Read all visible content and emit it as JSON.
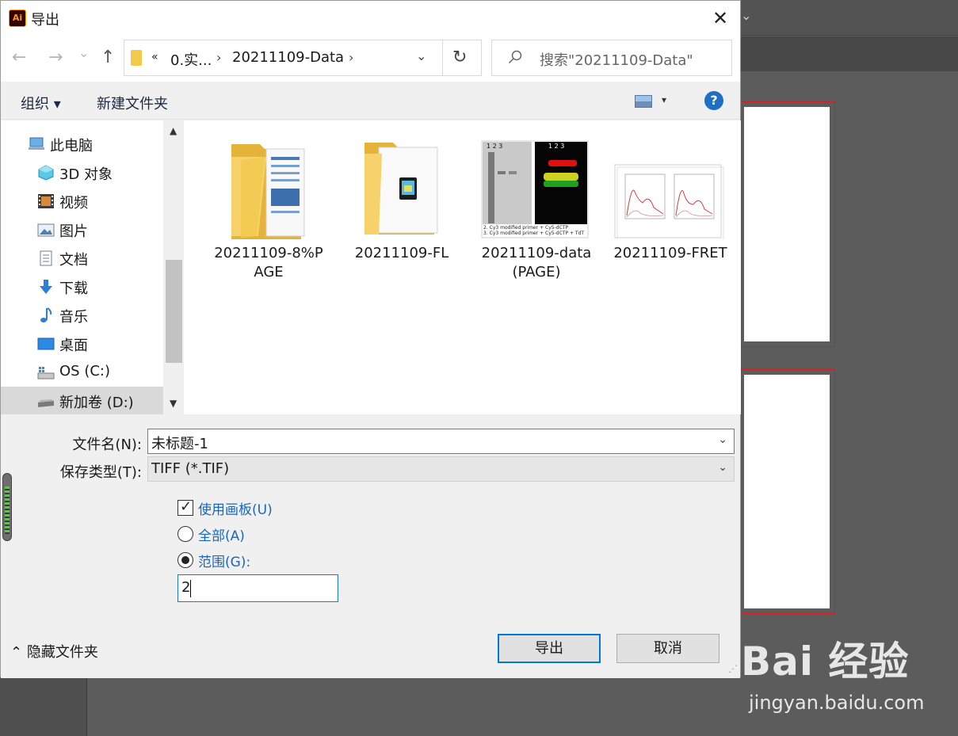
{
  "dialog": {
    "title": "导出",
    "app_icon_text": "Ai",
    "close_glyph": "✕"
  },
  "nav": {
    "back_glyph": "←",
    "forward_glyph": "→",
    "recent_glyph": "⌄",
    "up_glyph": "↑",
    "breadcrumb": [
      "«",
      "0.实...",
      "20211109-Data"
    ],
    "crumb_sep": "›",
    "dropdown_glyph": "⌄",
    "refresh_glyph": "↻",
    "search_placeholder": "搜索\"20211109-Data\""
  },
  "toolbar": {
    "organize": "组织 ▾",
    "new_folder": "新建文件夹",
    "view_dd": "▾",
    "help": "?"
  },
  "sidebar": {
    "items": [
      {
        "label": "此电脑",
        "icon": "computer-icon"
      },
      {
        "label": "3D 对象",
        "icon": "3d-objects-icon"
      },
      {
        "label": "视频",
        "icon": "video-icon"
      },
      {
        "label": "图片",
        "icon": "pictures-icon"
      },
      {
        "label": "文档",
        "icon": "documents-icon"
      },
      {
        "label": "下载",
        "icon": "downloads-icon"
      },
      {
        "label": "音乐",
        "icon": "music-icon"
      },
      {
        "label": "桌面",
        "icon": "desktop-icon"
      },
      {
        "label": "OS (C:)",
        "icon": "drive-c-icon"
      },
      {
        "label": "新加卷 (D:)",
        "icon": "drive-d-icon",
        "selected": true
      }
    ],
    "scroll_up": "▲",
    "scroll_down": "▼"
  },
  "files": [
    {
      "name_l1": "20211109-8%P",
      "name_l2": "AGE",
      "type": "folder-docs"
    },
    {
      "name_l1": "20211109-FL",
      "name_l2": "",
      "type": "folder-app"
    },
    {
      "name_l1": "20211109-data",
      "name_l2": "(PAGE)",
      "type": "gel-image"
    },
    {
      "name_l1": "20211109-FRET",
      "name_l2": "",
      "type": "chart-image"
    }
  ],
  "gel_thumb": {
    "lanes_left": "1 2 3",
    "lanes_right": "1  2  3",
    "caption_1": "2. Cy3 modified primer + Cy5-dCTP",
    "caption_2": "3. Cy3 modified primer + Cy5-dCTP + TdT"
  },
  "form": {
    "filename_label": "文件名(N):",
    "filename_value": "未标题-1",
    "filetype_label": "保存类型(T):",
    "filetype_value": "TIFF (*.TIF)",
    "dropdown_glyph": "⌄",
    "use_artboards": "使用画板(U)",
    "all": "全部(A)",
    "range": "范围(G):",
    "range_value": "2",
    "checkmark": "✓"
  },
  "footer": {
    "hide_folders": "隐藏文件夹",
    "hide_glyph": "⌃",
    "export_btn": "导出",
    "cancel_btn": "取消",
    "grip": "⋰"
  },
  "background": {
    "topbar_glyph": "⌄",
    "watermark_main": "Bai 经验",
    "watermark_sub": "jingyan.baidu.com"
  },
  "colors": {
    "accent_blue": "#0078d7",
    "artboard_border": "#d21e1e",
    "folder_yellow": "#f3c94c"
  }
}
